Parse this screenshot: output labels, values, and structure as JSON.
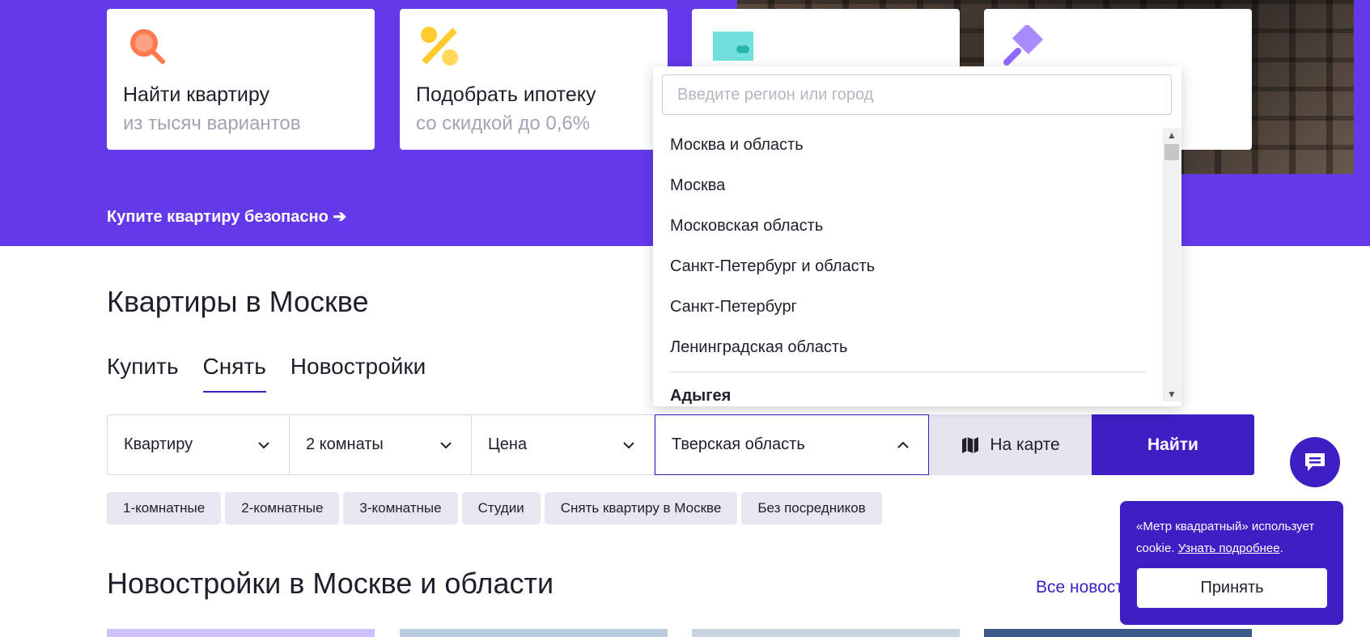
{
  "cards": [
    {
      "title": "Найти квартиру",
      "subtitle": "из тысяч вариантов",
      "icon": "search-icon",
      "color": "#ff7a4f"
    },
    {
      "title": "Подобрать ипотеку",
      "subtitle": "со скидкой до 0,6%",
      "icon": "percent-icon",
      "color": "#ffcb2f"
    },
    {
      "title": "",
      "subtitle": "",
      "icon": "card-icon",
      "color": "#6fe0da"
    },
    {
      "title": "",
      "subtitle": "",
      "icon": "hammer-icon",
      "color": "#a98bff"
    }
  ],
  "hero": {
    "safe_link": "Купите квартиру безопасно ➔"
  },
  "main": {
    "heading": "Квартиры в Москве",
    "tabs": [
      {
        "label": "Купить",
        "active": false
      },
      {
        "label": "Снять",
        "active": true
      },
      {
        "label": "Новостройки",
        "active": false
      }
    ]
  },
  "filters": {
    "type": "Квартиру",
    "rooms": "2 комнаты",
    "price": "Цена",
    "region": "Тверская область",
    "map_button": "На карте",
    "find_button": "Найти"
  },
  "region_dropdown": {
    "placeholder": "Введите регион или город",
    "options": [
      "Москва и область",
      "Москва",
      "Московская область",
      "Санкт-Петербург и область",
      "Санкт-Петербург",
      "Ленинградская область"
    ],
    "partial_option": "Адыгея"
  },
  "chips": [
    "1-комнатные",
    "2-комнатные",
    "3-комнатные",
    "Студии",
    "Снять квартиру в Москве",
    "Без посредников"
  ],
  "new_buildings": {
    "heading": "Новостройки в Москве и области",
    "all_link": "Все новост"
  },
  "cookie": {
    "text": "«Метр квадратный» использует cookie.",
    "link": "Узнать подробнее",
    "accept": "Принять"
  },
  "colors": {
    "brand": "#6339ea",
    "accent": "#3d1fc3"
  }
}
